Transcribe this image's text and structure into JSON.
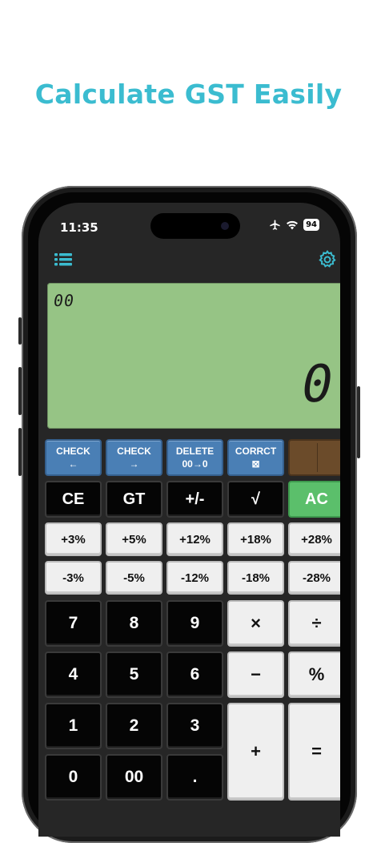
{
  "headline": "Calculate GST Easily",
  "status": {
    "time": "11:35",
    "battery": "94"
  },
  "display": {
    "gt": "00",
    "value": "0"
  },
  "rows": {
    "check_back": {
      "label": "CHECK",
      "sub": "←"
    },
    "check_fwd": {
      "label": "CHECK",
      "sub": "→"
    },
    "delete": {
      "label": "DELETE",
      "sub": "00→0"
    },
    "correct": {
      "label": "CORRCT",
      "sub": "⊠"
    },
    "ce": "CE",
    "gt": "GT",
    "sign": "+/-",
    "sqrt": "√",
    "ac": "AC",
    "plus3": "+3%",
    "plus5": "+5%",
    "plus12": "+12%",
    "plus18": "+18%",
    "plus28": "+28%",
    "minus3": "-3%",
    "minus5": "-5%",
    "minus12": "-12%",
    "minus18": "-18%",
    "minus28": "-28%",
    "k7": "7",
    "k8": "8",
    "k9": "9",
    "mul": "×",
    "div": "÷",
    "k4": "4",
    "k5": "5",
    "k6": "6",
    "sub": "−",
    "pct": "%",
    "k1": "1",
    "k2": "2",
    "k3": "3",
    "add": "+",
    "eq": "=",
    "k0": "0",
    "k00": "00",
    "dot": "."
  },
  "colors": {
    "accent": "#3bbcd0",
    "display": "#96c485",
    "check": "#4a7fb5",
    "ac": "#5bbf6b"
  },
  "icons": {
    "menu": "list-icon",
    "settings": "gear-icon"
  }
}
